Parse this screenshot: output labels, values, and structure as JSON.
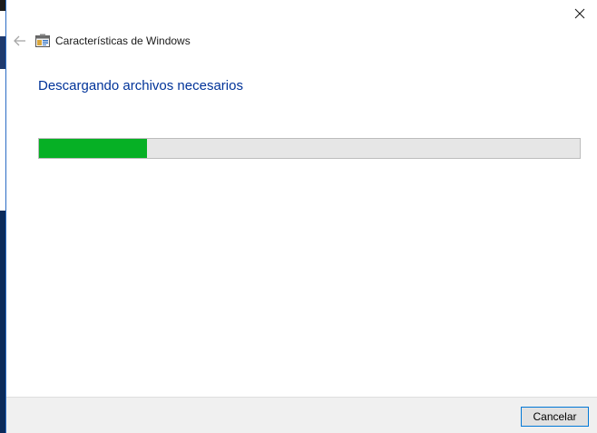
{
  "window": {
    "title": "Características de Windows",
    "close_icon": "close-icon",
    "back_icon": "back-arrow-icon",
    "app_icon": "windows-features-icon"
  },
  "main": {
    "heading": "Descargando archivos necesarios",
    "progress": {
      "percent": 20,
      "fill_color": "#06b025",
      "track_color": "#e6e6e6"
    }
  },
  "footer": {
    "cancel_label": "Cancelar"
  },
  "colors": {
    "heading": "#003399",
    "accent_border": "#0078d7"
  }
}
